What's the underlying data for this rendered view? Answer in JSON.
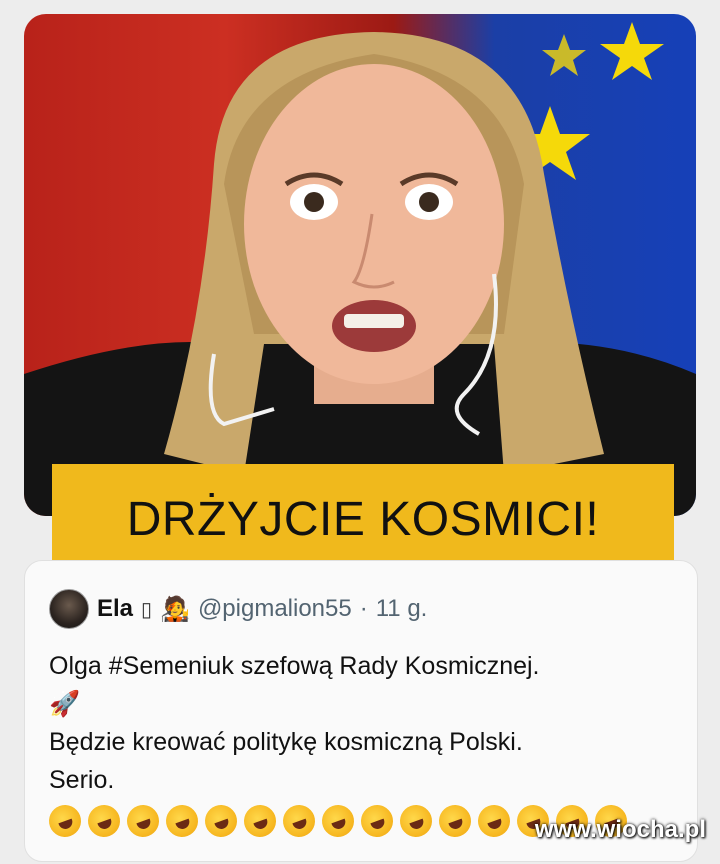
{
  "banner": {
    "text": "DRŻYJCIE KOSMICI!"
  },
  "tweet": {
    "author_name": "Ela",
    "name_glyph": "▯",
    "author_emoji": "🧑‍🎤",
    "handle": "@pigmalion55",
    "separator": "·",
    "time": "11 g.",
    "lines": [
      "Olga #Semeniuk szefową Rady Kosmicznej.",
      "🚀",
      "Będzie kreować politykę kosmiczną Polski.",
      "Serio."
    ],
    "laugh_emoji_count": 15
  },
  "watermark": "www.wiocha.pl",
  "colors": {
    "banner": "#f0b91c",
    "flag_blue": "#1640b8",
    "flag_star": "#f5d90a",
    "background_red": "#c02a1e"
  },
  "icons": [
    "rolling-on-floor-laughing-emoji",
    "rocket-emoji"
  ]
}
